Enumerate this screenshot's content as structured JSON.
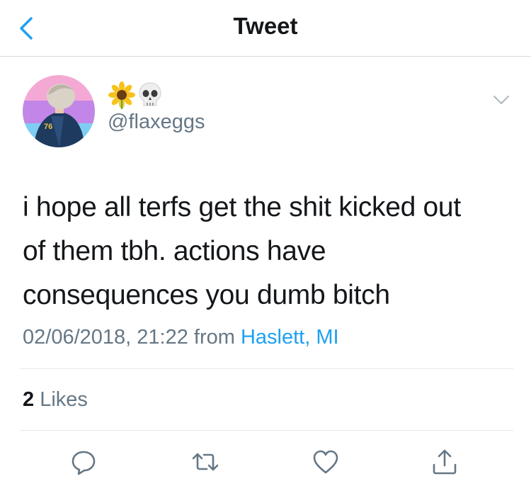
{
  "header": {
    "title": "Tweet",
    "back_icon": "chevron-left-icon"
  },
  "author": {
    "display_emoji": [
      "sunflower",
      "skull"
    ],
    "handle": "@flaxeggs",
    "avatar_jersey_number": "76",
    "avatar_stripe_colors": [
      "#f4a9d4",
      "#c285e8",
      "#7fcdf2"
    ]
  },
  "tweet": {
    "lines": [
      "i hope all terfs get the shit kicked out",
      "of them tbh. actions have",
      "consequences you dumb bitch"
    ],
    "timestamp": "02/06/2018, 21:22",
    "from_label": "from",
    "location": "Haslett, MI"
  },
  "stats": {
    "likes_count": "2",
    "likes_label": "Likes"
  },
  "actions": [
    {
      "name": "reply",
      "icon": "reply-icon"
    },
    {
      "name": "retweet",
      "icon": "retweet-icon"
    },
    {
      "name": "like",
      "icon": "heart-icon"
    },
    {
      "name": "share",
      "icon": "share-icon"
    }
  ],
  "colors": {
    "accent": "#1da1f2",
    "secondary_text": "#657786",
    "primary_text": "#14171a",
    "icon": "#657786",
    "divider": "#e1e8ed"
  }
}
